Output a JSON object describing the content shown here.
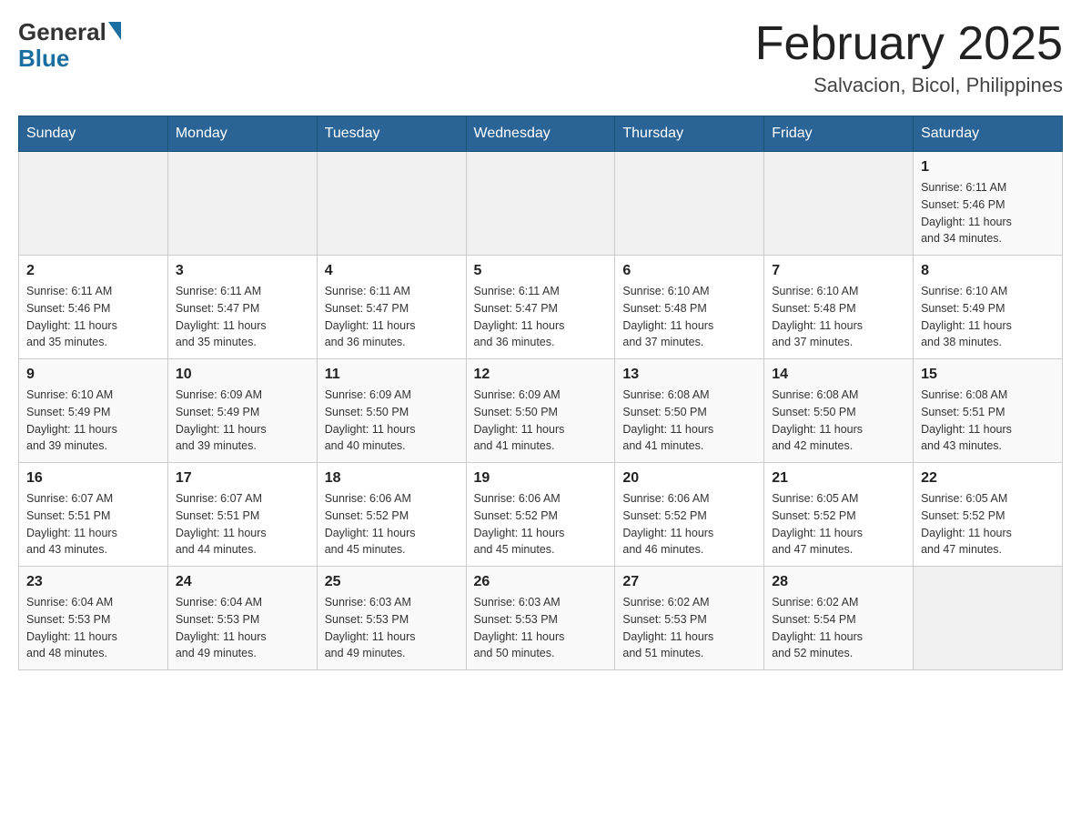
{
  "header": {
    "logo": {
      "general": "General",
      "blue": "Blue"
    },
    "title": "February 2025",
    "location": "Salvacion, Bicol, Philippines"
  },
  "days_of_week": [
    "Sunday",
    "Monday",
    "Tuesday",
    "Wednesday",
    "Thursday",
    "Friday",
    "Saturday"
  ],
  "weeks": [
    {
      "days": [
        {
          "num": "",
          "info": ""
        },
        {
          "num": "",
          "info": ""
        },
        {
          "num": "",
          "info": ""
        },
        {
          "num": "",
          "info": ""
        },
        {
          "num": "",
          "info": ""
        },
        {
          "num": "",
          "info": ""
        },
        {
          "num": "1",
          "info": "Sunrise: 6:11 AM\nSunset: 5:46 PM\nDaylight: 11 hours\nand 34 minutes."
        }
      ]
    },
    {
      "days": [
        {
          "num": "2",
          "info": "Sunrise: 6:11 AM\nSunset: 5:46 PM\nDaylight: 11 hours\nand 35 minutes."
        },
        {
          "num": "3",
          "info": "Sunrise: 6:11 AM\nSunset: 5:47 PM\nDaylight: 11 hours\nand 35 minutes."
        },
        {
          "num": "4",
          "info": "Sunrise: 6:11 AM\nSunset: 5:47 PM\nDaylight: 11 hours\nand 36 minutes."
        },
        {
          "num": "5",
          "info": "Sunrise: 6:11 AM\nSunset: 5:47 PM\nDaylight: 11 hours\nand 36 minutes."
        },
        {
          "num": "6",
          "info": "Sunrise: 6:10 AM\nSunset: 5:48 PM\nDaylight: 11 hours\nand 37 minutes."
        },
        {
          "num": "7",
          "info": "Sunrise: 6:10 AM\nSunset: 5:48 PM\nDaylight: 11 hours\nand 37 minutes."
        },
        {
          "num": "8",
          "info": "Sunrise: 6:10 AM\nSunset: 5:49 PM\nDaylight: 11 hours\nand 38 minutes."
        }
      ]
    },
    {
      "days": [
        {
          "num": "9",
          "info": "Sunrise: 6:10 AM\nSunset: 5:49 PM\nDaylight: 11 hours\nand 39 minutes."
        },
        {
          "num": "10",
          "info": "Sunrise: 6:09 AM\nSunset: 5:49 PM\nDaylight: 11 hours\nand 39 minutes."
        },
        {
          "num": "11",
          "info": "Sunrise: 6:09 AM\nSunset: 5:50 PM\nDaylight: 11 hours\nand 40 minutes."
        },
        {
          "num": "12",
          "info": "Sunrise: 6:09 AM\nSunset: 5:50 PM\nDaylight: 11 hours\nand 41 minutes."
        },
        {
          "num": "13",
          "info": "Sunrise: 6:08 AM\nSunset: 5:50 PM\nDaylight: 11 hours\nand 41 minutes."
        },
        {
          "num": "14",
          "info": "Sunrise: 6:08 AM\nSunset: 5:50 PM\nDaylight: 11 hours\nand 42 minutes."
        },
        {
          "num": "15",
          "info": "Sunrise: 6:08 AM\nSunset: 5:51 PM\nDaylight: 11 hours\nand 43 minutes."
        }
      ]
    },
    {
      "days": [
        {
          "num": "16",
          "info": "Sunrise: 6:07 AM\nSunset: 5:51 PM\nDaylight: 11 hours\nand 43 minutes."
        },
        {
          "num": "17",
          "info": "Sunrise: 6:07 AM\nSunset: 5:51 PM\nDaylight: 11 hours\nand 44 minutes."
        },
        {
          "num": "18",
          "info": "Sunrise: 6:06 AM\nSunset: 5:52 PM\nDaylight: 11 hours\nand 45 minutes."
        },
        {
          "num": "19",
          "info": "Sunrise: 6:06 AM\nSunset: 5:52 PM\nDaylight: 11 hours\nand 45 minutes."
        },
        {
          "num": "20",
          "info": "Sunrise: 6:06 AM\nSunset: 5:52 PM\nDaylight: 11 hours\nand 46 minutes."
        },
        {
          "num": "21",
          "info": "Sunrise: 6:05 AM\nSunset: 5:52 PM\nDaylight: 11 hours\nand 47 minutes."
        },
        {
          "num": "22",
          "info": "Sunrise: 6:05 AM\nSunset: 5:52 PM\nDaylight: 11 hours\nand 47 minutes."
        }
      ]
    },
    {
      "days": [
        {
          "num": "23",
          "info": "Sunrise: 6:04 AM\nSunset: 5:53 PM\nDaylight: 11 hours\nand 48 minutes."
        },
        {
          "num": "24",
          "info": "Sunrise: 6:04 AM\nSunset: 5:53 PM\nDaylight: 11 hours\nand 49 minutes."
        },
        {
          "num": "25",
          "info": "Sunrise: 6:03 AM\nSunset: 5:53 PM\nDaylight: 11 hours\nand 49 minutes."
        },
        {
          "num": "26",
          "info": "Sunrise: 6:03 AM\nSunset: 5:53 PM\nDaylight: 11 hours\nand 50 minutes."
        },
        {
          "num": "27",
          "info": "Sunrise: 6:02 AM\nSunset: 5:53 PM\nDaylight: 11 hours\nand 51 minutes."
        },
        {
          "num": "28",
          "info": "Sunrise: 6:02 AM\nSunset: 5:54 PM\nDaylight: 11 hours\nand 52 minutes."
        },
        {
          "num": "",
          "info": ""
        }
      ]
    }
  ]
}
